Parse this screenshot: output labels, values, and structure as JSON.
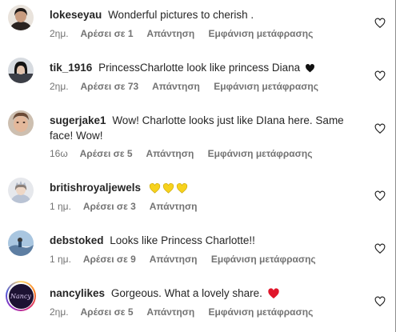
{
  "labels": {
    "likes_prefix": "Αρέσει σε",
    "reply": "Απάντηση",
    "translate": "Εμφάνιση μετάφρασης"
  },
  "comments": [
    {
      "username": "lokeseyau",
      "text": "Wonderful pictures to cherish .",
      "time": "2ημ.",
      "likes": "Αρέσει σε 1",
      "reply": "Απάντηση",
      "translate": "Εμφάνιση μετάφρασης",
      "emoji": []
    },
    {
      "username": "tik_1916",
      "text": "PrincessCharlotte look like princess Diana",
      "time": "2ημ.",
      "likes": "Αρέσει σε 73",
      "reply": "Απάντηση",
      "translate": "Εμφάνιση μετάφρασης",
      "emoji": [
        "black-heart-icon"
      ]
    },
    {
      "username": "sugerjake1",
      "text": "Wow! Charlotte looks just like DIana here. Same face! Wow!",
      "time": "16ω",
      "likes": "Αρέσει σε 5",
      "reply": "Απάντηση",
      "translate": "Εμφάνιση μετάφρασης",
      "emoji": []
    },
    {
      "username": "britishroyaljewels",
      "text": "",
      "time": "1 ημ.",
      "likes": "Αρέσει σε 3",
      "reply": "Απάντηση",
      "translate": "",
      "emoji": [
        "yellow-heart-icon",
        "yellow-heart-icon",
        "yellow-heart-icon"
      ]
    },
    {
      "username": "debstoked",
      "text": "Looks like Princess Charlotte!!",
      "time": "1 ημ.",
      "likes": "Αρέσει σε 9",
      "reply": "Απάντηση",
      "translate": "Εμφάνιση μετάφρασης",
      "emoji": []
    },
    {
      "username": "nancylikes",
      "text": "Gorgeous. What a lovely share.",
      "time": "2ημ.",
      "likes": "Αρέσει σε 5",
      "reply": "Απάντηση",
      "translate": "Εμφάνιση μετάφρασης",
      "emoji": [
        "red-heart-icon"
      ]
    }
  ],
  "avatar_labels": {
    "nancylikes": "Nancy"
  },
  "colors": {
    "text": "#262626",
    "meta": "#737373",
    "yellow_heart": "#f7d21d",
    "red_heart": "#e0162b",
    "black_heart": "#111111"
  }
}
